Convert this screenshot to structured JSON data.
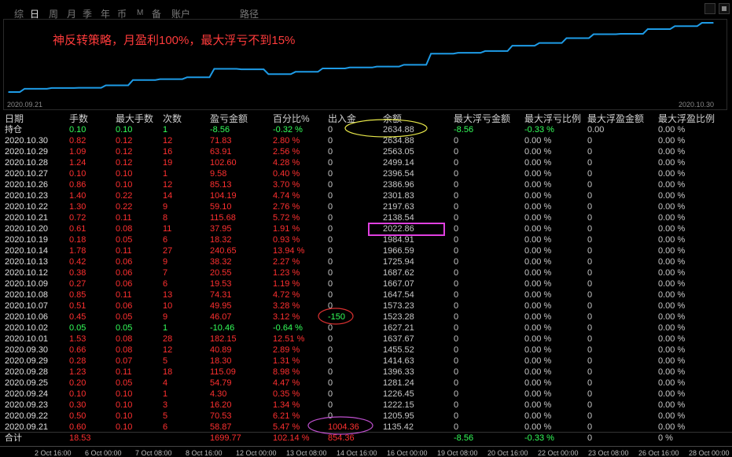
{
  "tabs": [
    {
      "label": "综",
      "active": false
    },
    {
      "label": "日",
      "active": true
    },
    {
      "label": "周",
      "active": false
    },
    {
      "label": "月",
      "active": false
    },
    {
      "label": "季",
      "active": false
    },
    {
      "label": "年",
      "active": false
    },
    {
      "label": "币",
      "active": false
    },
    {
      "label": "M",
      "active": false
    },
    {
      "label": "备",
      "active": false
    },
    {
      "label": "账户",
      "active": false
    },
    {
      "label": "路径",
      "active": false
    }
  ],
  "chart_caption": "神反转策略，月盈利100%，最大浮亏不到15%",
  "curve": {
    "start_label": "2020.09.21",
    "end_label": "2020.10.30",
    "line_color": "#1e9be6"
  },
  "chart_data": {
    "type": "line",
    "x": [
      "2020.09.21",
      "2020.09.22",
      "2020.09.23",
      "2020.09.24",
      "2020.09.25",
      "2020.09.28",
      "2020.09.29",
      "2020.09.30",
      "2020.10.01",
      "2020.10.02",
      "2020.10.06",
      "2020.10.07",
      "2020.10.08",
      "2020.10.09",
      "2020.10.12",
      "2020.10.13",
      "2020.10.14",
      "2020.10.19",
      "2020.10.20",
      "2020.10.21",
      "2020.10.22",
      "2020.10.23",
      "2020.10.26",
      "2020.10.27",
      "2020.10.28",
      "2020.10.29",
      "2020.10.30"
    ],
    "series": [
      {
        "values": [
          1135.42,
          1205.95,
          1222.15,
          1226.45,
          1281.24,
          1396.33,
          1414.63,
          1455.52,
          1637.67,
          1627.21,
          1523.28,
          1573.23,
          1647.54,
          1667.07,
          1687.62,
          1725.94,
          1966.59,
          1984.91,
          2022.86,
          2138.54,
          2197.63,
          2301.83,
          2386.96,
          2396.54,
          2499.14,
          2563.05,
          2634.88
        ]
      }
    ]
  },
  "columns": [
    "日期",
    "手数",
    "最大手数",
    "次数",
    "盈亏金额",
    "百分比%",
    "出入金",
    "余额",
    "最大浮亏金额",
    "最大浮亏比例",
    "最大浮盈金额",
    "最大浮盈比例"
  ],
  "holding": {
    "date": "持仓",
    "lots": "0.10",
    "max_lots": "0.10",
    "count": "1",
    "pnl": "-8.56",
    "pct": "-0.32 %",
    "inout": "0",
    "balance": "2634.88",
    "max_float_loss": "-8.56",
    "max_float_loss_pct": "-0.33 %",
    "max_float_profit": "0.00",
    "max_float_profit_pct": "0.00 %"
  },
  "rows": [
    {
      "date": "2020.10.30",
      "lots": "0.82",
      "max_lots": "0.12",
      "count": "12",
      "pnl": "71.83",
      "pct": "2.80 %",
      "inout": "0",
      "balance": "2634.88",
      "mfl": "0",
      "mflp": "0.00 %",
      "mfp": "0",
      "mfpp": "0.00 %",
      "sign": "pos"
    },
    {
      "date": "2020.10.29",
      "lots": "1.09",
      "max_lots": "0.12",
      "count": "16",
      "pnl": "63.91",
      "pct": "2.56 %",
      "inout": "0",
      "balance": "2563.05",
      "mfl": "0",
      "mflp": "0.00 %",
      "mfp": "0",
      "mfpp": "0.00 %",
      "sign": "pos"
    },
    {
      "date": "2020.10.28",
      "lots": "1.24",
      "max_lots": "0.12",
      "count": "19",
      "pnl": "102.60",
      "pct": "4.28 %",
      "inout": "0",
      "balance": "2499.14",
      "mfl": "0",
      "mflp": "0.00 %",
      "mfp": "0",
      "mfpp": "0.00 %",
      "sign": "pos"
    },
    {
      "date": "2020.10.27",
      "lots": "0.10",
      "max_lots": "0.10",
      "count": "1",
      "pnl": "9.58",
      "pct": "0.40 %",
      "inout": "0",
      "balance": "2396.54",
      "mfl": "0",
      "mflp": "0.00 %",
      "mfp": "0",
      "mfpp": "0.00 %",
      "sign": "pos"
    },
    {
      "date": "2020.10.26",
      "lots": "0.86",
      "max_lots": "0.10",
      "count": "12",
      "pnl": "85.13",
      "pct": "3.70 %",
      "inout": "0",
      "balance": "2386.96",
      "mfl": "0",
      "mflp": "0.00 %",
      "mfp": "0",
      "mfpp": "0.00 %",
      "sign": "pos"
    },
    {
      "date": "2020.10.23",
      "lots": "1.40",
      "max_lots": "0.22",
      "count": "14",
      "pnl": "104.19",
      "pct": "4.74 %",
      "inout": "0",
      "balance": "2301.83",
      "mfl": "0",
      "mflp": "0.00 %",
      "mfp": "0",
      "mfpp": "0.00 %",
      "sign": "pos"
    },
    {
      "date": "2020.10.22",
      "lots": "1.30",
      "max_lots": "0.22",
      "count": "9",
      "pnl": "59.10",
      "pct": "2.76 %",
      "inout": "0",
      "balance": "2197.63",
      "mfl": "0",
      "mflp": "0.00 %",
      "mfp": "0",
      "mfpp": "0.00 %",
      "sign": "pos"
    },
    {
      "date": "2020.10.21",
      "lots": "0.72",
      "max_lots": "0.11",
      "count": "8",
      "pnl": "115.68",
      "pct": "5.72 %",
      "inout": "0",
      "balance": "2138.54",
      "mfl": "0",
      "mflp": "0.00 %",
      "mfp": "0",
      "mfpp": "0.00 %",
      "sign": "pos"
    },
    {
      "date": "2020.10.20",
      "lots": "0.61",
      "max_lots": "0.08",
      "count": "11",
      "pnl": "37.95",
      "pct": "1.91 %",
      "inout": "0",
      "balance": "2022.86",
      "mfl": "0",
      "mflp": "0.00 %",
      "mfp": "0",
      "mfpp": "0.00 %",
      "sign": "pos"
    },
    {
      "date": "2020.10.19",
      "lots": "0.18",
      "max_lots": "0.05",
      "count": "6",
      "pnl": "18.32",
      "pct": "0.93 %",
      "inout": "0",
      "balance": "1984.91",
      "mfl": "0",
      "mflp": "0.00 %",
      "mfp": "0",
      "mfpp": "0.00 %",
      "sign": "pos"
    },
    {
      "date": "2020.10.14",
      "lots": "1.78",
      "max_lots": "0.11",
      "count": "27",
      "pnl": "240.65",
      "pct": "13.94 %",
      "inout": "0",
      "balance": "1966.59",
      "mfl": "0",
      "mflp": "0.00 %",
      "mfp": "0",
      "mfpp": "0.00 %",
      "sign": "pos"
    },
    {
      "date": "2020.10.13",
      "lots": "0.42",
      "max_lots": "0.06",
      "count": "9",
      "pnl": "38.32",
      "pct": "2.27 %",
      "inout": "0",
      "balance": "1725.94",
      "mfl": "0",
      "mflp": "0.00 %",
      "mfp": "0",
      "mfpp": "0.00 %",
      "sign": "pos"
    },
    {
      "date": "2020.10.12",
      "lots": "0.38",
      "max_lots": "0.06",
      "count": "7",
      "pnl": "20.55",
      "pct": "1.23 %",
      "inout": "0",
      "balance": "1687.62",
      "mfl": "0",
      "mflp": "0.00 %",
      "mfp": "0",
      "mfpp": "0.00 %",
      "sign": "pos"
    },
    {
      "date": "2020.10.09",
      "lots": "0.27",
      "max_lots": "0.06",
      "count": "6",
      "pnl": "19.53",
      "pct": "1.19 %",
      "inout": "0",
      "balance": "1667.07",
      "mfl": "0",
      "mflp": "0.00 %",
      "mfp": "0",
      "mfpp": "0.00 %",
      "sign": "pos"
    },
    {
      "date": "2020.10.08",
      "lots": "0.85",
      "max_lots": "0.11",
      "count": "13",
      "pnl": "74.31",
      "pct": "4.72 %",
      "inout": "0",
      "balance": "1647.54",
      "mfl": "0",
      "mflp": "0.00 %",
      "mfp": "0",
      "mfpp": "0.00 %",
      "sign": "pos"
    },
    {
      "date": "2020.10.07",
      "lots": "0.51",
      "max_lots": "0.06",
      "count": "10",
      "pnl": "49.95",
      "pct": "3.28 %",
      "inout": "0",
      "balance": "1573.23",
      "mfl": "0",
      "mflp": "0.00 %",
      "mfp": "0",
      "mfpp": "0.00 %",
      "sign": "pos"
    },
    {
      "date": "2020.10.06",
      "lots": "0.45",
      "max_lots": "0.05",
      "count": "9",
      "pnl": "46.07",
      "pct": "3.12 %",
      "inout": "-150",
      "balance": "1523.28",
      "mfl": "0",
      "mflp": "0.00 %",
      "mfp": "0",
      "mfpp": "0.00 %",
      "sign": "pos"
    },
    {
      "date": "2020.10.02",
      "lots": "0.05",
      "max_lots": "0.05",
      "count": "1",
      "pnl": "-10.46",
      "pct": "-0.64 %",
      "inout": "0",
      "balance": "1627.21",
      "mfl": "0",
      "mflp": "0.00 %",
      "mfp": "0",
      "mfpp": "0.00 %",
      "sign": "neg"
    },
    {
      "date": "2020.10.01",
      "lots": "1.53",
      "max_lots": "0.08",
      "count": "28",
      "pnl": "182.15",
      "pct": "12.51 %",
      "inout": "0",
      "balance": "1637.67",
      "mfl": "0",
      "mflp": "0.00 %",
      "mfp": "0",
      "mfpp": "0.00 %",
      "sign": "pos"
    },
    {
      "date": "2020.09.30",
      "lots": "0.66",
      "max_lots": "0.08",
      "count": "12",
      "pnl": "40.89",
      "pct": "2.89 %",
      "inout": "0",
      "balance": "1455.52",
      "mfl": "0",
      "mflp": "0.00 %",
      "mfp": "0",
      "mfpp": "0.00 %",
      "sign": "pos"
    },
    {
      "date": "2020.09.29",
      "lots": "0.28",
      "max_lots": "0.07",
      "count": "5",
      "pnl": "18.30",
      "pct": "1.31 %",
      "inout": "0",
      "balance": "1414.63",
      "mfl": "0",
      "mflp": "0.00 %",
      "mfp": "0",
      "mfpp": "0.00 %",
      "sign": "pos"
    },
    {
      "date": "2020.09.28",
      "lots": "1.23",
      "max_lots": "0.11",
      "count": "18",
      "pnl": "115.09",
      "pct": "8.98 %",
      "inout": "0",
      "balance": "1396.33",
      "mfl": "0",
      "mflp": "0.00 %",
      "mfp": "0",
      "mfpp": "0.00 %",
      "sign": "pos"
    },
    {
      "date": "2020.09.25",
      "lots": "0.20",
      "max_lots": "0.05",
      "count": "4",
      "pnl": "54.79",
      "pct": "4.47 %",
      "inout": "0",
      "balance": "1281.24",
      "mfl": "0",
      "mflp": "0.00 %",
      "mfp": "0",
      "mfpp": "0.00 %",
      "sign": "pos"
    },
    {
      "date": "2020.09.24",
      "lots": "0.10",
      "max_lots": "0.10",
      "count": "1",
      "pnl": "4.30",
      "pct": "0.35 %",
      "inout": "0",
      "balance": "1226.45",
      "mfl": "0",
      "mflp": "0.00 %",
      "mfp": "0",
      "mfpp": "0.00 %",
      "sign": "pos"
    },
    {
      "date": "2020.09.23",
      "lots": "0.30",
      "max_lots": "0.10",
      "count": "3",
      "pnl": "16.20",
      "pct": "1.34 %",
      "inout": "0",
      "balance": "1222.15",
      "mfl": "0",
      "mflp": "0.00 %",
      "mfp": "0",
      "mfpp": "0.00 %",
      "sign": "pos"
    },
    {
      "date": "2020.09.22",
      "lots": "0.50",
      "max_lots": "0.10",
      "count": "5",
      "pnl": "70.53",
      "pct": "6.21 %",
      "inout": "0",
      "balance": "1205.95",
      "mfl": "0",
      "mflp": "0.00 %",
      "mfp": "0",
      "mfpp": "0.00 %",
      "sign": "pos"
    },
    {
      "date": "2020.09.21",
      "lots": "0.60",
      "max_lots": "0.10",
      "count": "6",
      "pnl": "58.87",
      "pct": "5.47 %",
      "inout": "1004.36",
      "balance": "1135.42",
      "mfl": "0",
      "mflp": "0.00 %",
      "mfp": "0",
      "mfpp": "0.00 %",
      "sign": "pos"
    }
  ],
  "total": {
    "label": "合计",
    "lots": "18.53",
    "pnl": "1699.77",
    "pct": "102.14 %",
    "inout": "854.36",
    "max_float_loss": "-8.56",
    "max_float_loss_pct": "-0.33 %",
    "max_float_profit": "0",
    "max_float_profit_pct": "0 %"
  },
  "time_axis": [
    "2 Oct 16:00",
    "6 Oct 00:00",
    "7 Oct 08:00",
    "8 Oct 16:00",
    "12 Oct 00:00",
    "13 Oct 08:00",
    "14 Oct 16:00",
    "16 Oct 00:00",
    "19 Oct 08:00",
    "20 Oct 16:00",
    "22 Oct 00:00",
    "23 Oct 08:00",
    "26 Oct 16:00",
    "28 Oct 00:00"
  ],
  "annotation_colors": {
    "yellow": "#e8e84a",
    "magenta": "#e040e0",
    "red": "#d83030",
    "purple": "#c050d0"
  }
}
